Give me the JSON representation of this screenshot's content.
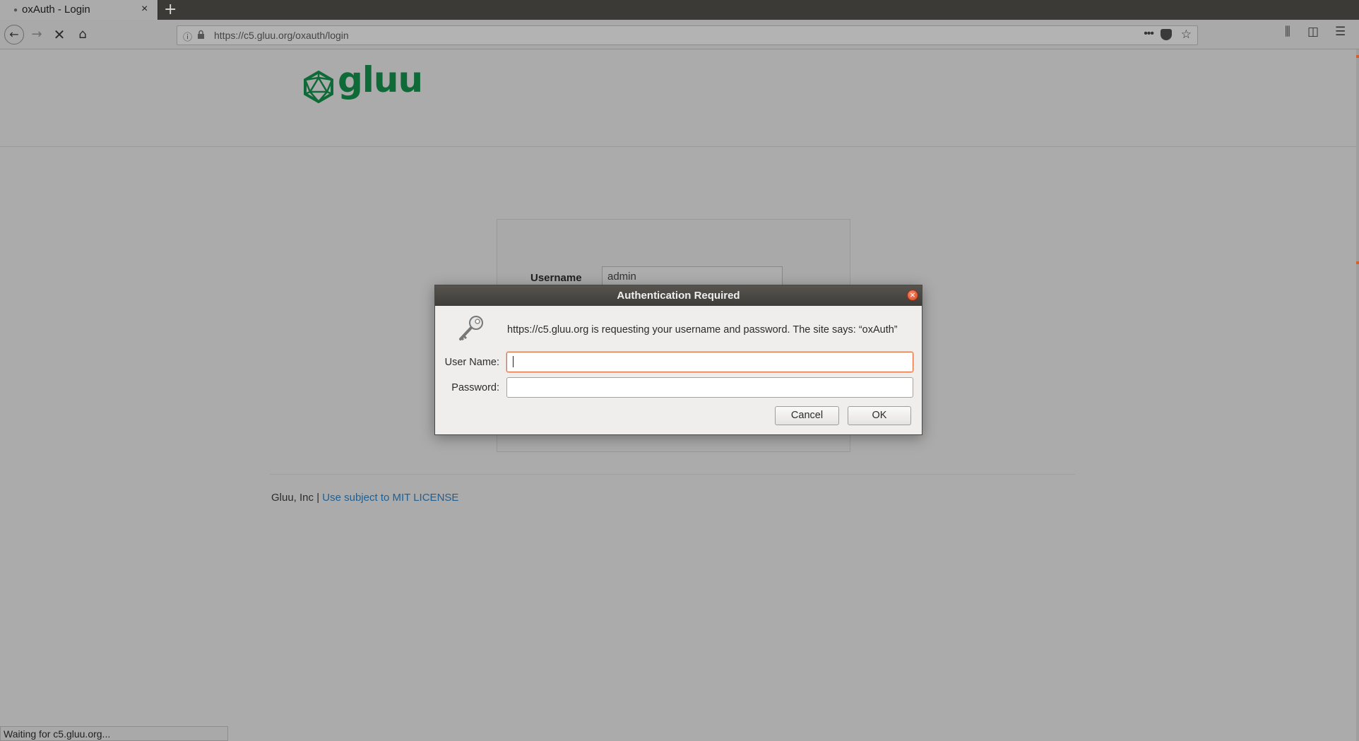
{
  "browser": {
    "tab_title": "oxAuth - Login",
    "tab_close": "×",
    "new_tab": "+",
    "url": "https://c5.gluu.org/oxauth/login",
    "url_more": "•••"
  },
  "page": {
    "logo_text": "gluu",
    "username_label": "Username",
    "username_value": "admin",
    "footer_company": "Gluu, Inc",
    "footer_separator": "|",
    "footer_link": "Use subject to MIT LICENSE"
  },
  "dialog": {
    "title": "Authentication Required",
    "message": "https://c5.gluu.org is requesting your username and password. The site says: “oxAuth”",
    "username_label": "User Name:",
    "username_value": "",
    "password_label": "Password:",
    "password_value": "",
    "cancel_label": "Cancel",
    "ok_label": "OK",
    "close_symbol": "×"
  },
  "status": {
    "text": "Waiting for c5.gluu.org..."
  },
  "colors": {
    "brand_green": "#0e6a36",
    "link_blue": "#1f5f92",
    "focus_orange": "#e2703e"
  }
}
